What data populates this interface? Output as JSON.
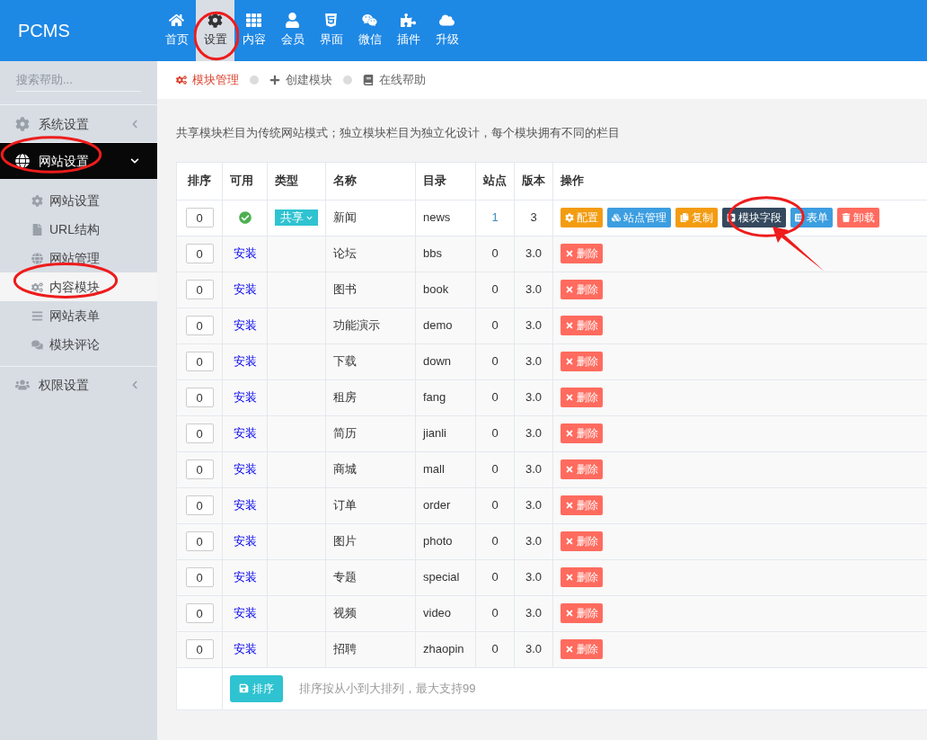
{
  "logo": "PCMS",
  "nav": [
    {
      "label": "首页",
      "selected": false
    },
    {
      "label": "设置",
      "selected": true
    },
    {
      "label": "内容",
      "selected": false
    },
    {
      "label": "会员",
      "selected": false
    },
    {
      "label": "界面",
      "selected": false
    },
    {
      "label": "微信",
      "selected": false
    },
    {
      "label": "插件",
      "selected": false
    },
    {
      "label": "升级",
      "selected": false
    }
  ],
  "sidebar": {
    "search": {
      "placeholder": "搜索帮助..."
    },
    "items": [
      {
        "label": "系统设置",
        "expanded": false,
        "selected": false
      },
      {
        "label": "网站设置",
        "expanded": true,
        "selected": true,
        "children": [
          {
            "label": "网站设置",
            "selected": false
          },
          {
            "label": "URL结构",
            "selected": false
          },
          {
            "label": "网站管理",
            "selected": false
          },
          {
            "label": "内容模块",
            "selected": true
          },
          {
            "label": "网站表单",
            "selected": false
          },
          {
            "label": "模块评论",
            "selected": false
          }
        ]
      },
      {
        "label": "权限设置",
        "expanded": false,
        "selected": false
      }
    ]
  },
  "tabs": [
    {
      "label": "模块管理",
      "selected": true
    },
    {
      "label": "创建模块",
      "selected": false
    },
    {
      "label": "在线帮助",
      "selected": false
    }
  ],
  "description": "共享模块栏目为传统网站模式；独立模块栏目为独立化设计，每个模块拥有不同的栏目",
  "table": {
    "columns": [
      "排序",
      "可用",
      "类型",
      "名称",
      "目录",
      "站点",
      "版本",
      "操作"
    ],
    "rows": [
      {
        "order": "0",
        "available": {
          "kind": "check"
        },
        "type": "共享",
        "name": "新闻",
        "dir": "news",
        "sites": "1",
        "version": "3",
        "actions": [
          {
            "label": "配置",
            "color": "#f39c12"
          },
          {
            "label": "站点管理",
            "color": "#3c9ee0"
          },
          {
            "label": "复制",
            "color": "#f39c12"
          },
          {
            "label": "模块字段",
            "color": "#34495e"
          },
          {
            "label": "表单",
            "color": "#3c9ee0"
          },
          {
            "label": "卸载",
            "color": "#ff6b5e"
          }
        ]
      },
      {
        "order": "0",
        "available": {
          "kind": "link",
          "text": "安装"
        },
        "name": "论坛",
        "dir": "bbs",
        "sites": "0",
        "version": "3.0",
        "actions": [
          {
            "label": "删除",
            "color": "#ff6b5e"
          }
        ]
      },
      {
        "order": "0",
        "available": {
          "kind": "link",
          "text": "安装"
        },
        "name": "图书",
        "dir": "book",
        "sites": "0",
        "version": "3.0",
        "actions": [
          {
            "label": "删除",
            "color": "#ff6b5e"
          }
        ]
      },
      {
        "order": "0",
        "available": {
          "kind": "link",
          "text": "安装"
        },
        "name": "功能演示",
        "dir": "demo",
        "sites": "0",
        "version": "3.0",
        "actions": [
          {
            "label": "删除",
            "color": "#ff6b5e"
          }
        ]
      },
      {
        "order": "0",
        "available": {
          "kind": "link",
          "text": "安装"
        },
        "name": "下载",
        "dir": "down",
        "sites": "0",
        "version": "3.0",
        "actions": [
          {
            "label": "删除",
            "color": "#ff6b5e"
          }
        ]
      },
      {
        "order": "0",
        "available": {
          "kind": "link",
          "text": "安装"
        },
        "name": "租房",
        "dir": "fang",
        "sites": "0",
        "version": "3.0",
        "actions": [
          {
            "label": "删除",
            "color": "#ff6b5e"
          }
        ]
      },
      {
        "order": "0",
        "available": {
          "kind": "link",
          "text": "安装"
        },
        "name": "简历",
        "dir": "jianli",
        "sites": "0",
        "version": "3.0",
        "actions": [
          {
            "label": "删除",
            "color": "#ff6b5e"
          }
        ]
      },
      {
        "order": "0",
        "available": {
          "kind": "link",
          "text": "安装"
        },
        "name": "商城",
        "dir": "mall",
        "sites": "0",
        "version": "3.0",
        "actions": [
          {
            "label": "删除",
            "color": "#ff6b5e"
          }
        ]
      },
      {
        "order": "0",
        "available": {
          "kind": "link",
          "text": "安装"
        },
        "name": "订单",
        "dir": "order",
        "sites": "0",
        "version": "3.0",
        "actions": [
          {
            "label": "删除",
            "color": "#ff6b5e"
          }
        ]
      },
      {
        "order": "0",
        "available": {
          "kind": "link",
          "text": "安装"
        },
        "name": "图片",
        "dir": "photo",
        "sites": "0",
        "version": "3.0",
        "actions": [
          {
            "label": "删除",
            "color": "#ff6b5e"
          }
        ]
      },
      {
        "order": "0",
        "available": {
          "kind": "link",
          "text": "安装"
        },
        "name": "专题",
        "dir": "special",
        "sites": "0",
        "version": "3.0",
        "actions": [
          {
            "label": "删除",
            "color": "#ff6b5e"
          }
        ]
      },
      {
        "order": "0",
        "available": {
          "kind": "link",
          "text": "安装"
        },
        "name": "视频",
        "dir": "video",
        "sites": "0",
        "version": "3.0",
        "actions": [
          {
            "label": "删除",
            "color": "#ff6b5e"
          }
        ]
      },
      {
        "order": "0",
        "available": {
          "kind": "link",
          "text": "安装"
        },
        "name": "招聘",
        "dir": "zhaopin",
        "sites": "0",
        "version": "3.0",
        "actions": [
          {
            "label": "删除",
            "color": "#ff6b5e"
          }
        ]
      }
    ],
    "footer": {
      "button": "排序",
      "note": "排序按从小到大排列，最大支持99"
    }
  }
}
